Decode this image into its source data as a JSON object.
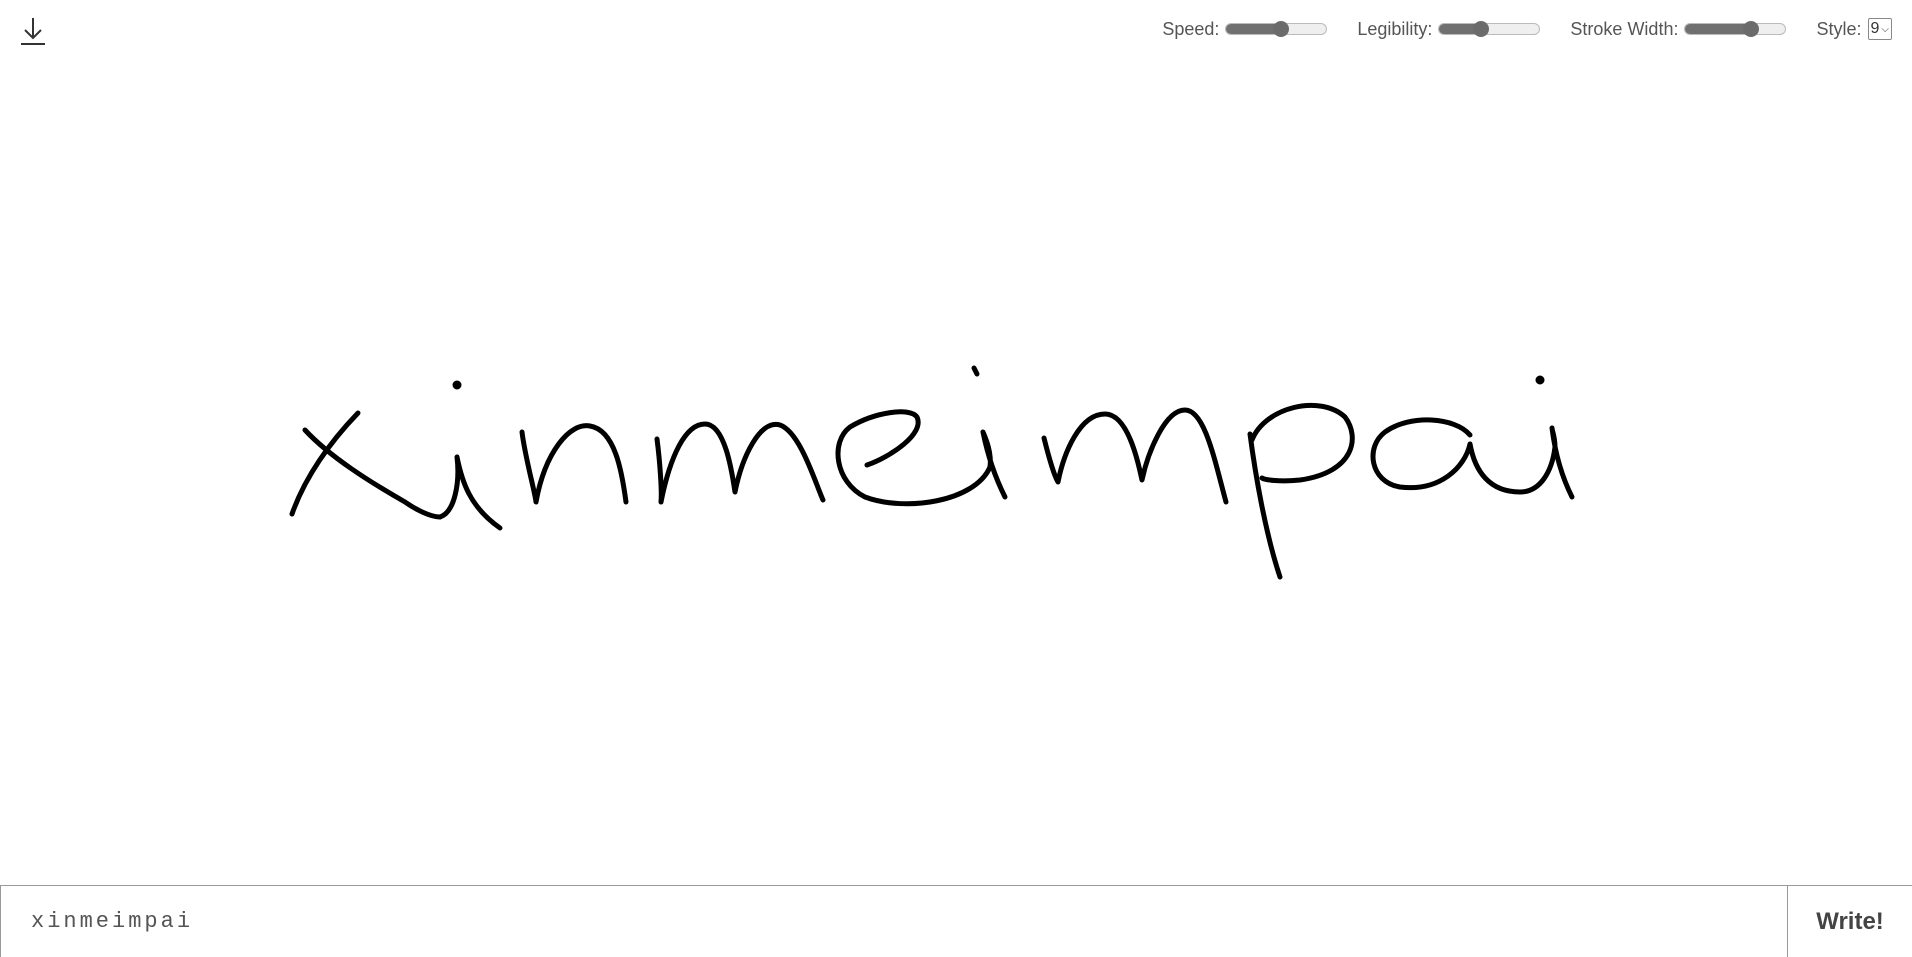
{
  "toolbar": {
    "download_icon": "download-icon",
    "speed": {
      "label": "Speed:",
      "value": 0.55
    },
    "legibility": {
      "label": "Legibility:",
      "value": 0.42
    },
    "stroke_width": {
      "label": "Stroke Width:",
      "value": 0.66
    },
    "style": {
      "label": "Style:",
      "selected": "9"
    }
  },
  "canvas": {
    "handwritten_text": "xinmeimpai"
  },
  "input": {
    "value": "xinmeimpai",
    "placeholder": ""
  },
  "write_button": {
    "label": "Write!"
  }
}
